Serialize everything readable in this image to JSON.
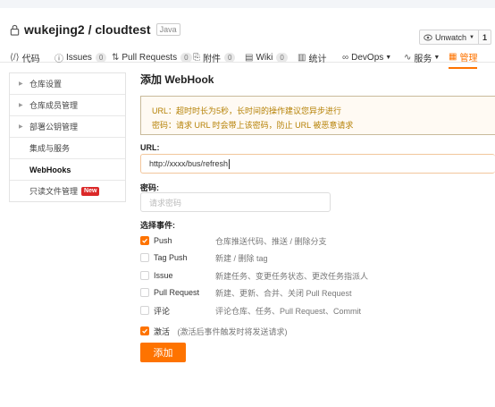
{
  "repo": {
    "title": "wukejing2 / cloudtest",
    "lang": "Java"
  },
  "watch": {
    "label": "Unwatch",
    "count": "1"
  },
  "tabs": [
    {
      "icon": "code-icon",
      "glyph": "⟨/⟩",
      "label": "代码"
    },
    {
      "icon": "issues-icon",
      "glyph": "ⓘ",
      "label": "Issues",
      "count": "0"
    },
    {
      "icon": "pull-request-icon",
      "glyph": "⇅",
      "label": "Pull Requests",
      "count": "0"
    },
    {
      "icon": "attachment-icon",
      "glyph": "⎘",
      "label": "附件",
      "count": "0"
    },
    {
      "icon": "wiki-icon",
      "glyph": "▤",
      "label": "Wiki",
      "count": "0"
    },
    {
      "icon": "stats-icon",
      "glyph": "▥",
      "label": "统计"
    },
    {
      "icon": "devops-icon",
      "glyph": "∞",
      "label": "DevOps"
    },
    {
      "icon": "service-icon",
      "glyph": "∿",
      "label": "服务"
    },
    {
      "icon": "manage-icon",
      "glyph": "▦",
      "label": "管理"
    }
  ],
  "sidebar": {
    "items": [
      {
        "label": "仓库设置"
      },
      {
        "label": "仓库成员管理"
      },
      {
        "label": "部署公钥管理"
      },
      {
        "label": "集成与服务"
      },
      {
        "label": "WebHooks"
      },
      {
        "label": "只读文件管理",
        "badge": "New"
      }
    ]
  },
  "main": {
    "title": "添加 WebHook",
    "notice": [
      "URL：超时时长为5秒，长时间的操作建议您异步进行",
      "密码：请求 URL 时会带上该密码，防止 URL 被恶意请求"
    ],
    "url_label": "URL:",
    "url_value": "http://xxxx/bus/refresh",
    "password_label": "密码:",
    "password_placeholder": "请求密码",
    "events_label": "选择事件:",
    "events": [
      {
        "name": "Push",
        "desc": "仓库推送代码、推送 / 删除分支",
        "checked": true
      },
      {
        "name": "Tag Push",
        "desc": "新建 / 删除 tag",
        "checked": false
      },
      {
        "name": "Issue",
        "desc": "新建任务、变更任务状态、更改任务指派人",
        "checked": false
      },
      {
        "name": "Pull Request",
        "desc": "新建、更新、合并、关闭 Pull Request",
        "checked": false
      },
      {
        "name": "评论",
        "desc": "评论仓库、任务、Pull Request、Commit",
        "checked": false
      }
    ],
    "active": {
      "label": "激活",
      "hint": "(激活后事件触发时将发送请求)",
      "checked": true
    },
    "submit_label": "添加"
  }
}
